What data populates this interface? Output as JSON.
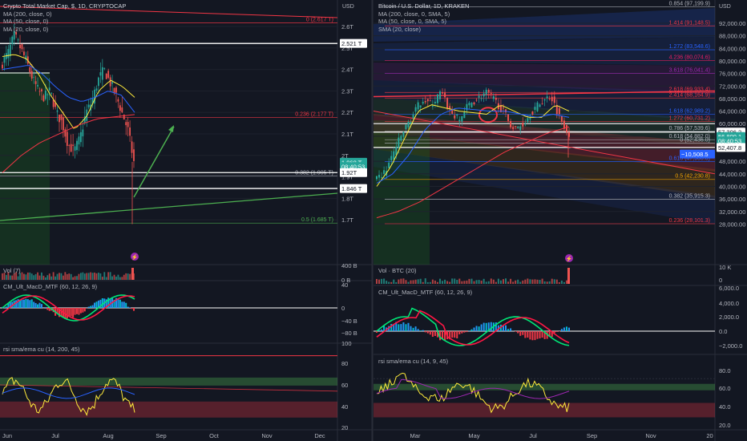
{
  "left_chart": {
    "title": "Crypto Total Market Cap, $, 1D, CRYPTOCAP",
    "indicators": [
      "MA (200, close, 0)",
      "MA (50, close, 0)",
      "MA (20, close, 0)"
    ],
    "currency": "USD",
    "price_ticks": [
      "2.6T",
      "2.5T",
      "2.4T",
      "2.3T",
      "2.2T",
      "2.1T",
      "2T",
      "1.9T",
      "1.8T",
      "1.7T"
    ],
    "time_ticks": [
      "Jun",
      "Jul",
      "Aug",
      "Sep",
      "Oct",
      "Nov",
      "Dec"
    ],
    "price_tags": [
      {
        "text": "2.521 T",
        "value": 2.521,
        "bg": "#ffffff",
        "fg": "#131722"
      },
      {
        "text": "1.968 T",
        "value": 1.968,
        "bg": "#26a69a",
        "fg": "#ffffff"
      },
      {
        "text": "08:40:53",
        "value": 1.948,
        "bg": "#26a69a",
        "fg": "#ffffff"
      },
      {
        "text": "1.92T",
        "value": 1.92,
        "bg": "#ffffff",
        "fg": "#131722"
      },
      {
        "text": "1.846 T",
        "value": 1.846,
        "bg": "#ffffff",
        "fg": "#131722"
      }
    ],
    "fib_labels": [
      {
        "text": "0 (2.617 T)",
        "value": 2.617,
        "color": "#f23645"
      },
      {
        "text": "0.236 (2.177 T)",
        "value": 2.177,
        "color": "#f23645"
      },
      {
        "text": "0.382 (1.905 T)",
        "value": 1.905,
        "color": "#b2b5be"
      },
      {
        "text": "0.5 (1.685 T)",
        "value": 1.685,
        "color": "#4caf50"
      }
    ],
    "vol_label": "Vol (7)",
    "vol_ticks": [
      "400 B",
      "0 B"
    ],
    "macd_label": "CM_Ult_MacD_MTF (60, 12, 26, 9)",
    "macd_ticks": [
      "40",
      "0",
      "−40 B",
      "−80 B"
    ],
    "rsi_label": "rsi sma/ema cu (14, 200, 45)",
    "rsi_ticks": [
      "100",
      "80",
      "60",
      "40",
      "20"
    ]
  },
  "right_chart": {
    "title": "Bitcoin / U.S. Dollar, 1D, KRAKEN",
    "indicators": [
      "MA (200, close, 0, SMA, 5)",
      "MA (50, close, 0, SMA, 5)",
      "SMA (20, close)"
    ],
    "currency": "USD",
    "price_ticks": [
      "92,000.00",
      "88,000.00",
      "84,000.00",
      "80,000.00",
      "76,000.00",
      "72,000.00",
      "68,000.00",
      "64,000.00",
      "60,000.00",
      "56,000.00",
      "52,000.00",
      "48,000.00",
      "44,000.00",
      "40,000.00",
      "36,000.00",
      "32,000.00",
      "28,000.00"
    ],
    "time_ticks": [
      "Mar",
      "May",
      "Jul",
      "Sep",
      "Nov",
      "20"
    ],
    "price_tags": [
      {
        "text": "57,306.2",
        "value": 57306,
        "bg": "#ffffff",
        "fg": "#131722"
      },
      {
        "text": "56,800.1",
        "value": 55900,
        "bg": "#26a69a",
        "fg": "#ffffff"
      },
      {
        "text": "08:40:53",
        "value": 54500,
        "bg": "#26a69a",
        "fg": "#ffffff"
      },
      {
        "text": "52,407.8",
        "value": 52408,
        "bg": "#ffffff",
        "fg": "#131722"
      },
      {
        "text": "−10,508.5",
        "value": 50300,
        "bg": "#2962ff",
        "fg": "#ffffff"
      }
    ],
    "fib_labels": [
      {
        "text": "0.854 (97,199.9)",
        "value": 97200,
        "color": "#b2b5be"
      },
      {
        "text": "1.414 (91,148.5)",
        "value": 91148,
        "color": "#f23645"
      },
      {
        "text": "1.272 (83,548.6)",
        "value": 83549,
        "color": "#2962ff"
      },
      {
        "text": "4.236 (80,074.6)",
        "value": 80075,
        "color": "#e91e63"
      },
      {
        "text": "3.618 (76,041.4)",
        "value": 76041,
        "color": "#9c27b0"
      },
      {
        "text": "2.618 (69,933.4)",
        "value": 69933,
        "color": "#f23645"
      },
      {
        "text": "2.414 (68,164.9)",
        "value": 68165,
        "color": "#f23645"
      },
      {
        "text": "1.618 (62,989.2)",
        "value": 62989,
        "color": "#2962ff"
      },
      {
        "text": "1.272 (60,731.2)",
        "value": 60731,
        "color": "#f23645"
      },
      {
        "text": "0.786 (57,539.6)",
        "value": 57540,
        "color": "#b2b5be"
      },
      {
        "text": "0.618 (54,882.0)",
        "value": 54882,
        "color": "#b2b5be"
      },
      {
        "text": "0 (52,436.0)",
        "value": 53800,
        "color": "#b2b5be"
      },
      {
        "text": "0.618 (47,900.0)",
        "value": 47900,
        "color": "#2962ff"
      },
      {
        "text": "0.5 (42,230.8)",
        "value": 42231,
        "color": "#f7a600"
      },
      {
        "text": "0.382 (35,915.3)",
        "value": 35915,
        "color": "#b2b5be"
      },
      {
        "text": "0.236 (28,101.3)",
        "value": 28101,
        "color": "#f23645"
      }
    ],
    "vol_label": "Vol · BTC (20)",
    "vol_ticks": [
      "10 K",
      "0"
    ],
    "macd_label": "CM_Ult_MacD_MTF (60, 12, 26, 9)",
    "macd_ticks": [
      "6,000.0",
      "4,000.0",
      "2,000.0",
      "0.0",
      "−2,000.0"
    ],
    "rsi_label": "rsi sma/ema cu (14, 9, 45)",
    "rsi_ticks": [
      "80.0",
      "60.0",
      "40.0",
      "20.0"
    ]
  },
  "chart_data": [
    {
      "type": "candlestick",
      "title": "Crypto Total Market Cap, $, 1D, CRYPTOCAP",
      "x": [
        "Jun",
        "Jul",
        "Aug",
        "Sep",
        "Oct",
        "Nov",
        "Dec"
      ],
      "ylabel": "USD",
      "ylim": [
        1.66,
        2.66
      ],
      "close": [
        2.43,
        2.48,
        2.56,
        2.5,
        2.44,
        2.36,
        2.3,
        2.27,
        2.3,
        2.2,
        2.15,
        2.05,
        2.02,
        2.08,
        2.2,
        2.25,
        2.35,
        2.4,
        2.34,
        2.28,
        2.2,
        2.12,
        1.97
      ],
      "series_lines": [
        {
          "name": "MA (200, close, 0)",
          "color": "#f23645"
        },
        {
          "name": "MA (50, close, 0)",
          "color": "#2962ff"
        },
        {
          "name": "MA (20, close, 0)",
          "color": "#ffeb3b"
        }
      ]
    },
    {
      "type": "candlestick",
      "title": "Bitcoin / U.S. Dollar, 1D, KRAKEN",
      "x": [
        "Mar",
        "May",
        "Jul",
        "Sep",
        "Nov",
        "20"
      ],
      "ylabel": "USD",
      "ylim": [
        26000,
        98000
      ],
      "close": [
        42000,
        45000,
        52000,
        58000,
        63000,
        68000,
        66000,
        70000,
        64000,
        61000,
        66000,
        68000,
        70000,
        67000,
        63000,
        58000,
        60000,
        64000,
        67000,
        69000,
        62000,
        56800
      ],
      "series_lines": [
        {
          "name": "MA (200, close, 0, SMA, 5)",
          "color": "#f23645"
        },
        {
          "name": "MA (50, close, 0, SMA, 5)",
          "color": "#2962ff"
        },
        {
          "name": "SMA (20, close)",
          "color": "#ffeb3b"
        }
      ]
    }
  ]
}
